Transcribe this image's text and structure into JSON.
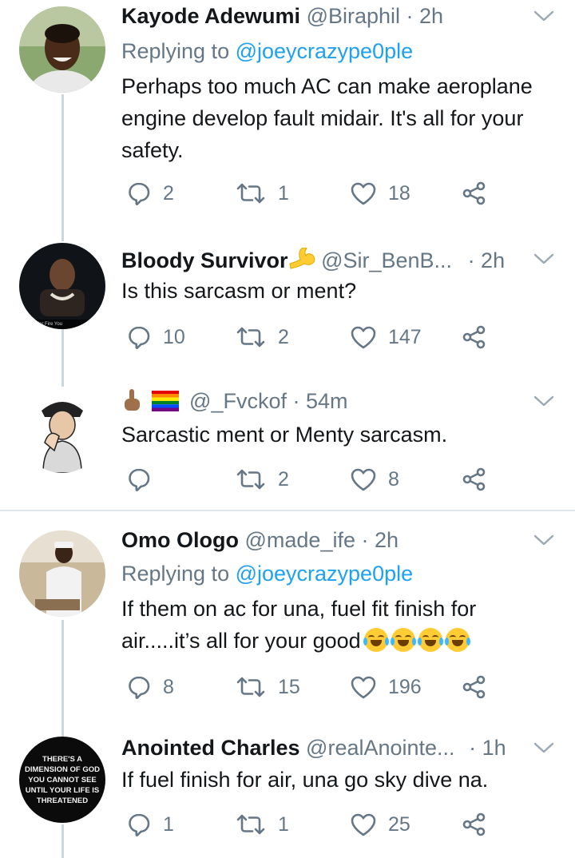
{
  "tweets": [
    {
      "name": "Kayode Adewumi",
      "handle": "@Biraphil",
      "time": "· 2h",
      "replying_prefix": "Replying to ",
      "replying_handle": "@joeycrazype0ple",
      "text": "Perhaps too much AC can make aeroplane engine develop fault midair. It's all for your safety.",
      "replies": "2",
      "retweets": "1",
      "likes": "18"
    },
    {
      "name": "Bloody Survivor",
      "name_emoji": "flexed-biceps-emoji",
      "handle": "@Sir_BenB...",
      "time": "· 2h",
      "text": "Is this sarcasm or ment?",
      "replies": "10",
      "retweets": "2",
      "likes": "147",
      "avatar_caption": "Thunder Fire You"
    },
    {
      "name_emojis": [
        "middle-finger-emoji",
        "rainbow-flag-emoji"
      ],
      "handle": "@_Fvckof",
      "time": "· 54m",
      "text": "Sarcastic ment or Menty sarcasm.",
      "replies": "",
      "retweets": "2",
      "likes": "8"
    },
    {
      "name": "Omo Ologo",
      "handle": "@made_ife",
      "time": "· 2h",
      "replying_prefix": "Replying to ",
      "replying_handle": "@joeycrazype0ple",
      "text": "If them on ac for una, fuel fit finish for air.....it’s all for your good",
      "text_emojis": [
        "face-with-tears-of-joy-emoji",
        "face-with-tears-of-joy-emoji",
        "face-with-tears-of-joy-emoji",
        "face-with-tears-of-joy-emoji"
      ],
      "replies": "8",
      "retweets": "15",
      "likes": "196"
    },
    {
      "name": "Anointed Charles",
      "handle": "@realAnointe...",
      "time": "· 1h",
      "text": "If fuel finish for air, una go sky dive na.",
      "replies": "1",
      "retweets": "1",
      "likes": "25",
      "avatar_text": [
        "THERE'S A",
        "DIMENSION OF GOD",
        "YOU CANNOT SEE",
        "UNTIL YOUR LIFE IS",
        "THREATENED"
      ]
    }
  ],
  "icons": {
    "reply": "reply-bubble-icon",
    "retweet": "retweet-icon",
    "like": "heart-icon",
    "share": "share-icon",
    "menu": "chevron-down-icon"
  },
  "colors": {
    "text": "#14171a",
    "muted": "#657786",
    "link": "#1da1f2",
    "thread": "#ccd6dd"
  }
}
